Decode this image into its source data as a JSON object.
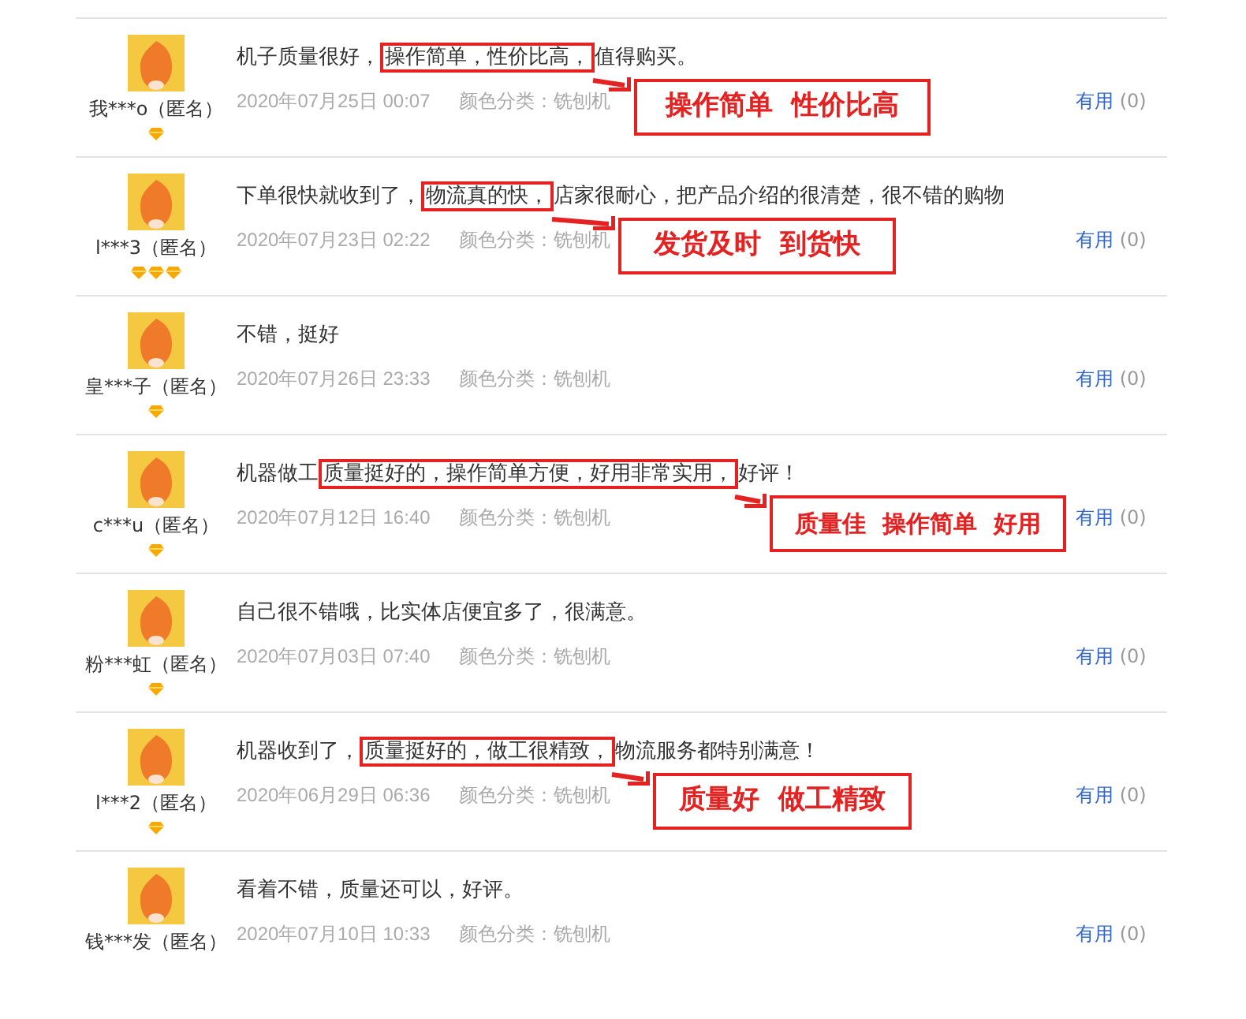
{
  "reviews": [
    {
      "user": "我***o（匿名）",
      "rank": [
        {
          "kind": "diamond"
        }
      ],
      "before": "机子质量很好，",
      "highlight": "操作简单，性价比高，",
      "after": "值得购买。",
      "date": "2020年07月25日 00:07",
      "category": "颜色分类：铣刨机",
      "helpful": "有用",
      "helpful_count": "(0)",
      "callout": "操作简单  性价比高"
    },
    {
      "user": "l***3（匿名）",
      "rank": [
        {
          "kind": "diamond"
        },
        {
          "kind": "diamond"
        },
        {
          "kind": "diamond"
        }
      ],
      "before": "下单很快就收到了，",
      "highlight": "物流真的快，",
      "after": "店家很耐心，把产品介绍的很清楚，很不错的购物",
      "date": "2020年07月23日 02:22",
      "category": "颜色分类：铣刨机",
      "helpful": "有用",
      "helpful_count": "(0)",
      "callout": "发货及时  到货快"
    },
    {
      "user": "皇***子（匿名）",
      "rank": [
        {
          "kind": "diamond"
        }
      ],
      "before": "不错，挺好",
      "date": "2020年07月26日 23:33",
      "category": "颜色分类：铣刨机",
      "helpful": "有用",
      "helpful_count": "(0)"
    },
    {
      "user": "c***u（匿名）",
      "rank": [
        {
          "kind": "diamond"
        }
      ],
      "before": "机器做工",
      "highlight": "质量挺好的，操作简单方便，好用非常实用，",
      "after": "好评！",
      "date": "2020年07月12日 16:40",
      "category": "颜色分类：铣刨机",
      "helpful": "有用",
      "helpful_count": "(0)",
      "callout": "质量佳  操作简单  好用"
    },
    {
      "user": "粉***虹（匿名）",
      "rank": [
        {
          "kind": "diamond"
        }
      ],
      "before": "自己很不错哦，比实体店便宜多了，很满意。",
      "date": "2020年07月03日 07:40",
      "category": "颜色分类：铣刨机",
      "helpful": "有用",
      "helpful_count": "(0)"
    },
    {
      "user": "l***2（匿名）",
      "rank": [
        {
          "kind": "diamond"
        }
      ],
      "before": "机器收到了，",
      "highlight": "质量挺好的，做工很精致，",
      "after": "物流服务都特别满意！",
      "date": "2020年06月29日 06:36",
      "category": "颜色分类：铣刨机",
      "helpful": "有用",
      "helpful_count": "(0)",
      "callout": "质量好  做工精致"
    },
    {
      "user": "钱***发（匿名）",
      "before": "看着不错，质量还可以，好评。",
      "date": "2020年07月10日 10:33",
      "category": "颜色分类：铣刨机",
      "helpful": "有用",
      "helpful_count": "(0)"
    }
  ]
}
